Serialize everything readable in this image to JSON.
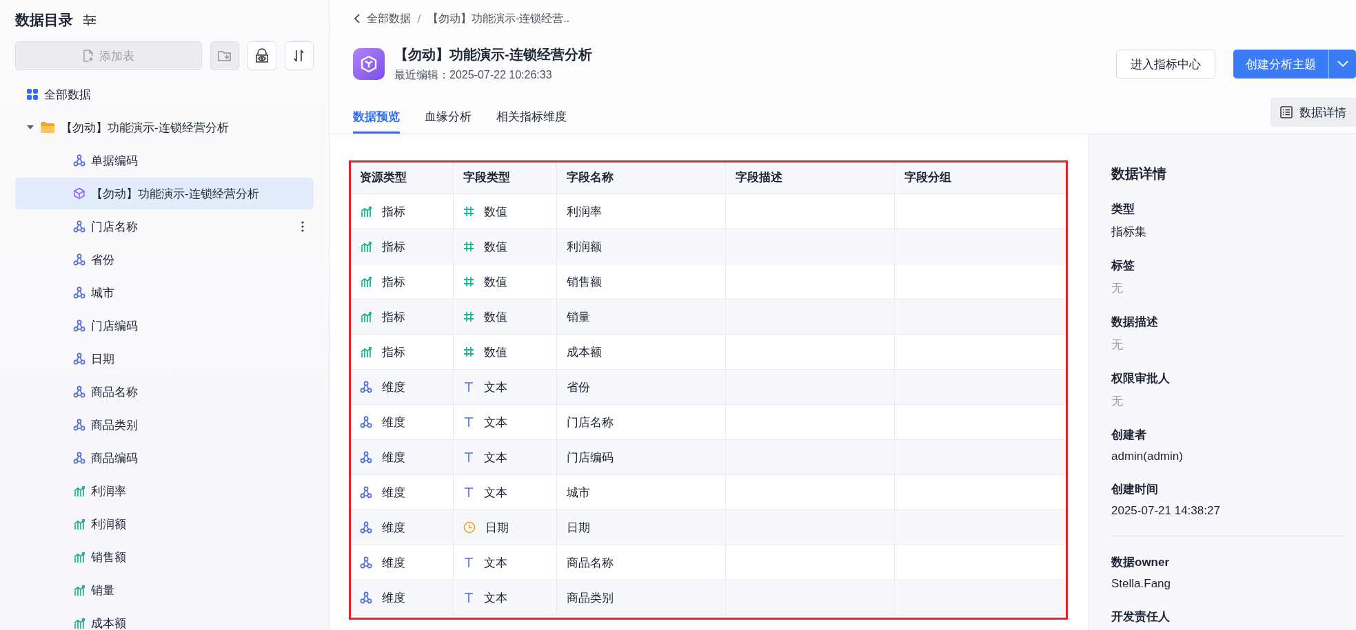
{
  "sidebar": {
    "title": "数据目录",
    "add_button": "添加表",
    "tree": [
      {
        "label": "全部数据",
        "kind": "all",
        "selected": false
      },
      {
        "label": "【勿动】功能演示-连锁经营分析",
        "kind": "folder",
        "selected": false,
        "expanded": true,
        "children": [
          {
            "label": "单据编码",
            "kind": "dimension",
            "selected": false,
            "hovered": false
          },
          {
            "label": "【勿动】功能演示-连锁经营分析",
            "kind": "dataset",
            "selected": true,
            "hovered": false
          },
          {
            "label": "门店名称",
            "kind": "dimension",
            "selected": false,
            "hovered": true
          },
          {
            "label": "省份",
            "kind": "dimension",
            "selected": false,
            "hovered": false
          },
          {
            "label": "城市",
            "kind": "dimension",
            "selected": false,
            "hovered": false
          },
          {
            "label": "门店编码",
            "kind": "dimension",
            "selected": false,
            "hovered": false
          },
          {
            "label": "日期",
            "kind": "dimension",
            "selected": false,
            "hovered": false
          },
          {
            "label": "商品名称",
            "kind": "dimension",
            "selected": false,
            "hovered": false
          },
          {
            "label": "商品类别",
            "kind": "dimension",
            "selected": false,
            "hovered": false
          },
          {
            "label": "商品编码",
            "kind": "dimension",
            "selected": false,
            "hovered": false
          },
          {
            "label": "利润率",
            "kind": "metric",
            "selected": false,
            "hovered": false
          },
          {
            "label": "利润额",
            "kind": "metric",
            "selected": false,
            "hovered": false
          },
          {
            "label": "销售额",
            "kind": "metric",
            "selected": false,
            "hovered": false
          },
          {
            "label": "销量",
            "kind": "metric",
            "selected": false,
            "hovered": false
          },
          {
            "label": "成本额",
            "kind": "metric",
            "selected": false,
            "hovered": false
          }
        ]
      }
    ]
  },
  "breadcrumb": [
    "全部数据",
    "【勿动】功能演示-连锁经营.."
  ],
  "header": {
    "title": "【勿动】功能演示-连锁经营分析",
    "subtitle": "最近编辑：2025-07-22 10:26:33",
    "secondary_button": "进入指标中心",
    "primary_button": "创建分析主题"
  },
  "tabs": [
    {
      "label": "数据预览",
      "selected": true
    },
    {
      "label": "血缘分析",
      "selected": false
    },
    {
      "label": "相关指标维度",
      "selected": false
    }
  ],
  "details_toggle": "数据详情",
  "table": {
    "columns": [
      "资源类型",
      "字段类型",
      "字段名称",
      "字段描述",
      "字段分组"
    ],
    "rows": [
      {
        "resource": {
          "kind": "metric",
          "label": "指标"
        },
        "field_type": {
          "kind": "number",
          "label": "数值"
        },
        "name": "利润率"
      },
      {
        "resource": {
          "kind": "metric",
          "label": "指标"
        },
        "field_type": {
          "kind": "number",
          "label": "数值"
        },
        "name": "利润额"
      },
      {
        "resource": {
          "kind": "metric",
          "label": "指标"
        },
        "field_type": {
          "kind": "number",
          "label": "数值"
        },
        "name": "销售额"
      },
      {
        "resource": {
          "kind": "metric",
          "label": "指标"
        },
        "field_type": {
          "kind": "number",
          "label": "数值"
        },
        "name": "销量"
      },
      {
        "resource": {
          "kind": "metric",
          "label": "指标"
        },
        "field_type": {
          "kind": "number",
          "label": "数值"
        },
        "name": "成本额"
      },
      {
        "resource": {
          "kind": "dimension",
          "label": "维度"
        },
        "field_type": {
          "kind": "text",
          "label": "文本"
        },
        "name": "省份"
      },
      {
        "resource": {
          "kind": "dimension",
          "label": "维度"
        },
        "field_type": {
          "kind": "text",
          "label": "文本"
        },
        "name": "门店名称"
      },
      {
        "resource": {
          "kind": "dimension",
          "label": "维度"
        },
        "field_type": {
          "kind": "text",
          "label": "文本"
        },
        "name": "门店编码"
      },
      {
        "resource": {
          "kind": "dimension",
          "label": "维度"
        },
        "field_type": {
          "kind": "text",
          "label": "文本"
        },
        "name": "城市"
      },
      {
        "resource": {
          "kind": "dimension",
          "label": "维度"
        },
        "field_type": {
          "kind": "date",
          "label": "日期"
        },
        "name": "日期"
      },
      {
        "resource": {
          "kind": "dimension",
          "label": "维度"
        },
        "field_type": {
          "kind": "text",
          "label": "文本"
        },
        "name": "商品名称"
      },
      {
        "resource": {
          "kind": "dimension",
          "label": "维度"
        },
        "field_type": {
          "kind": "text",
          "label": "文本"
        },
        "name": "商品类别"
      }
    ]
  },
  "details": {
    "title": "数据详情",
    "sections": [
      {
        "items": [
          {
            "label": "类型",
            "value": "指标集",
            "muted": false
          },
          {
            "label": "标签",
            "value": "无",
            "muted": true
          },
          {
            "label": "数据描述",
            "value": "无",
            "muted": true
          },
          {
            "label": "权限审批人",
            "value": "无",
            "muted": true
          },
          {
            "label": "创建者",
            "value": "admin(admin)",
            "muted": false
          },
          {
            "label": "创建时间",
            "value": "2025-07-21 14:38:27",
            "muted": false
          }
        ]
      },
      {
        "items": [
          {
            "label": "数据owner",
            "value": "Stella.Fang",
            "muted": false
          },
          {
            "label": "开发责任人"
          }
        ]
      }
    ]
  }
}
